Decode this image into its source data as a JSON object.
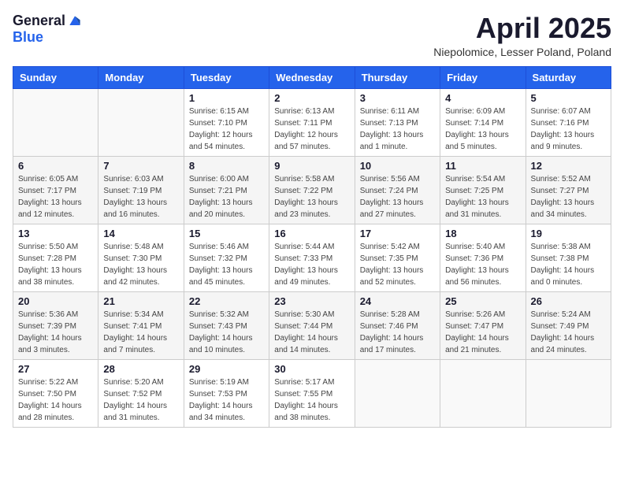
{
  "header": {
    "logo_general": "General",
    "logo_blue": "Blue",
    "month_title": "April 2025",
    "location": "Niepolomice, Lesser Poland, Poland"
  },
  "days_of_week": [
    "Sunday",
    "Monday",
    "Tuesday",
    "Wednesday",
    "Thursday",
    "Friday",
    "Saturday"
  ],
  "weeks": [
    [
      {
        "day": "",
        "info": ""
      },
      {
        "day": "",
        "info": ""
      },
      {
        "day": "1",
        "info": "Sunrise: 6:15 AM\nSunset: 7:10 PM\nDaylight: 12 hours\nand 54 minutes."
      },
      {
        "day": "2",
        "info": "Sunrise: 6:13 AM\nSunset: 7:11 PM\nDaylight: 12 hours\nand 57 minutes."
      },
      {
        "day": "3",
        "info": "Sunrise: 6:11 AM\nSunset: 7:13 PM\nDaylight: 13 hours\nand 1 minute."
      },
      {
        "day": "4",
        "info": "Sunrise: 6:09 AM\nSunset: 7:14 PM\nDaylight: 13 hours\nand 5 minutes."
      },
      {
        "day": "5",
        "info": "Sunrise: 6:07 AM\nSunset: 7:16 PM\nDaylight: 13 hours\nand 9 minutes."
      }
    ],
    [
      {
        "day": "6",
        "info": "Sunrise: 6:05 AM\nSunset: 7:17 PM\nDaylight: 13 hours\nand 12 minutes."
      },
      {
        "day": "7",
        "info": "Sunrise: 6:03 AM\nSunset: 7:19 PM\nDaylight: 13 hours\nand 16 minutes."
      },
      {
        "day": "8",
        "info": "Sunrise: 6:00 AM\nSunset: 7:21 PM\nDaylight: 13 hours\nand 20 minutes."
      },
      {
        "day": "9",
        "info": "Sunrise: 5:58 AM\nSunset: 7:22 PM\nDaylight: 13 hours\nand 23 minutes."
      },
      {
        "day": "10",
        "info": "Sunrise: 5:56 AM\nSunset: 7:24 PM\nDaylight: 13 hours\nand 27 minutes."
      },
      {
        "day": "11",
        "info": "Sunrise: 5:54 AM\nSunset: 7:25 PM\nDaylight: 13 hours\nand 31 minutes."
      },
      {
        "day": "12",
        "info": "Sunrise: 5:52 AM\nSunset: 7:27 PM\nDaylight: 13 hours\nand 34 minutes."
      }
    ],
    [
      {
        "day": "13",
        "info": "Sunrise: 5:50 AM\nSunset: 7:28 PM\nDaylight: 13 hours\nand 38 minutes."
      },
      {
        "day": "14",
        "info": "Sunrise: 5:48 AM\nSunset: 7:30 PM\nDaylight: 13 hours\nand 42 minutes."
      },
      {
        "day": "15",
        "info": "Sunrise: 5:46 AM\nSunset: 7:32 PM\nDaylight: 13 hours\nand 45 minutes."
      },
      {
        "day": "16",
        "info": "Sunrise: 5:44 AM\nSunset: 7:33 PM\nDaylight: 13 hours\nand 49 minutes."
      },
      {
        "day": "17",
        "info": "Sunrise: 5:42 AM\nSunset: 7:35 PM\nDaylight: 13 hours\nand 52 minutes."
      },
      {
        "day": "18",
        "info": "Sunrise: 5:40 AM\nSunset: 7:36 PM\nDaylight: 13 hours\nand 56 minutes."
      },
      {
        "day": "19",
        "info": "Sunrise: 5:38 AM\nSunset: 7:38 PM\nDaylight: 14 hours\nand 0 minutes."
      }
    ],
    [
      {
        "day": "20",
        "info": "Sunrise: 5:36 AM\nSunset: 7:39 PM\nDaylight: 14 hours\nand 3 minutes."
      },
      {
        "day": "21",
        "info": "Sunrise: 5:34 AM\nSunset: 7:41 PM\nDaylight: 14 hours\nand 7 minutes."
      },
      {
        "day": "22",
        "info": "Sunrise: 5:32 AM\nSunset: 7:43 PM\nDaylight: 14 hours\nand 10 minutes."
      },
      {
        "day": "23",
        "info": "Sunrise: 5:30 AM\nSunset: 7:44 PM\nDaylight: 14 hours\nand 14 minutes."
      },
      {
        "day": "24",
        "info": "Sunrise: 5:28 AM\nSunset: 7:46 PM\nDaylight: 14 hours\nand 17 minutes."
      },
      {
        "day": "25",
        "info": "Sunrise: 5:26 AM\nSunset: 7:47 PM\nDaylight: 14 hours\nand 21 minutes."
      },
      {
        "day": "26",
        "info": "Sunrise: 5:24 AM\nSunset: 7:49 PM\nDaylight: 14 hours\nand 24 minutes."
      }
    ],
    [
      {
        "day": "27",
        "info": "Sunrise: 5:22 AM\nSunset: 7:50 PM\nDaylight: 14 hours\nand 28 minutes."
      },
      {
        "day": "28",
        "info": "Sunrise: 5:20 AM\nSunset: 7:52 PM\nDaylight: 14 hours\nand 31 minutes."
      },
      {
        "day": "29",
        "info": "Sunrise: 5:19 AM\nSunset: 7:53 PM\nDaylight: 14 hours\nand 34 minutes."
      },
      {
        "day": "30",
        "info": "Sunrise: 5:17 AM\nSunset: 7:55 PM\nDaylight: 14 hours\nand 38 minutes."
      },
      {
        "day": "",
        "info": ""
      },
      {
        "day": "",
        "info": ""
      },
      {
        "day": "",
        "info": ""
      }
    ]
  ]
}
